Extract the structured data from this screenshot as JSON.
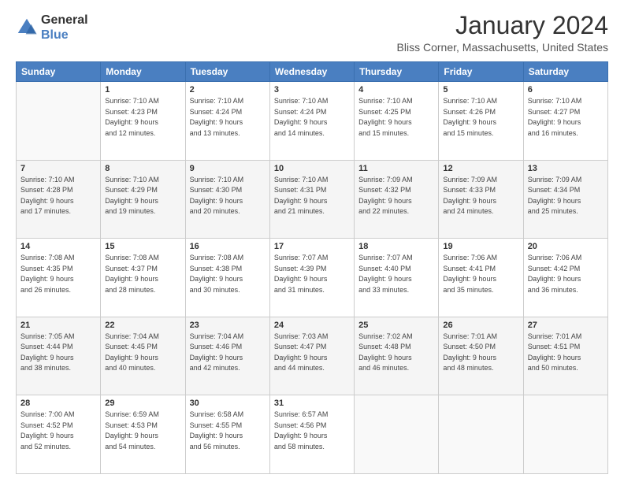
{
  "header": {
    "logo": {
      "line1": "General",
      "line2": "Blue"
    },
    "title": "January 2024",
    "subtitle": "Bliss Corner, Massachusetts, United States"
  },
  "calendar": {
    "days_of_week": [
      "Sunday",
      "Monday",
      "Tuesday",
      "Wednesday",
      "Thursday",
      "Friday",
      "Saturday"
    ],
    "weeks": [
      [
        {
          "day": "",
          "info": ""
        },
        {
          "day": "1",
          "info": "Sunrise: 7:10 AM\nSunset: 4:23 PM\nDaylight: 9 hours\nand 12 minutes."
        },
        {
          "day": "2",
          "info": "Sunrise: 7:10 AM\nSunset: 4:24 PM\nDaylight: 9 hours\nand 13 minutes."
        },
        {
          "day": "3",
          "info": "Sunrise: 7:10 AM\nSunset: 4:24 PM\nDaylight: 9 hours\nand 14 minutes."
        },
        {
          "day": "4",
          "info": "Sunrise: 7:10 AM\nSunset: 4:25 PM\nDaylight: 9 hours\nand 15 minutes."
        },
        {
          "day": "5",
          "info": "Sunrise: 7:10 AM\nSunset: 4:26 PM\nDaylight: 9 hours\nand 15 minutes."
        },
        {
          "day": "6",
          "info": "Sunrise: 7:10 AM\nSunset: 4:27 PM\nDaylight: 9 hours\nand 16 minutes."
        }
      ],
      [
        {
          "day": "7",
          "info": "Sunrise: 7:10 AM\nSunset: 4:28 PM\nDaylight: 9 hours\nand 17 minutes."
        },
        {
          "day": "8",
          "info": "Sunrise: 7:10 AM\nSunset: 4:29 PM\nDaylight: 9 hours\nand 19 minutes."
        },
        {
          "day": "9",
          "info": "Sunrise: 7:10 AM\nSunset: 4:30 PM\nDaylight: 9 hours\nand 20 minutes."
        },
        {
          "day": "10",
          "info": "Sunrise: 7:10 AM\nSunset: 4:31 PM\nDaylight: 9 hours\nand 21 minutes."
        },
        {
          "day": "11",
          "info": "Sunrise: 7:09 AM\nSunset: 4:32 PM\nDaylight: 9 hours\nand 22 minutes."
        },
        {
          "day": "12",
          "info": "Sunrise: 7:09 AM\nSunset: 4:33 PM\nDaylight: 9 hours\nand 24 minutes."
        },
        {
          "day": "13",
          "info": "Sunrise: 7:09 AM\nSunset: 4:34 PM\nDaylight: 9 hours\nand 25 minutes."
        }
      ],
      [
        {
          "day": "14",
          "info": "Sunrise: 7:08 AM\nSunset: 4:35 PM\nDaylight: 9 hours\nand 26 minutes."
        },
        {
          "day": "15",
          "info": "Sunrise: 7:08 AM\nSunset: 4:37 PM\nDaylight: 9 hours\nand 28 minutes."
        },
        {
          "day": "16",
          "info": "Sunrise: 7:08 AM\nSunset: 4:38 PM\nDaylight: 9 hours\nand 30 minutes."
        },
        {
          "day": "17",
          "info": "Sunrise: 7:07 AM\nSunset: 4:39 PM\nDaylight: 9 hours\nand 31 minutes."
        },
        {
          "day": "18",
          "info": "Sunrise: 7:07 AM\nSunset: 4:40 PM\nDaylight: 9 hours\nand 33 minutes."
        },
        {
          "day": "19",
          "info": "Sunrise: 7:06 AM\nSunset: 4:41 PM\nDaylight: 9 hours\nand 35 minutes."
        },
        {
          "day": "20",
          "info": "Sunrise: 7:06 AM\nSunset: 4:42 PM\nDaylight: 9 hours\nand 36 minutes."
        }
      ],
      [
        {
          "day": "21",
          "info": "Sunrise: 7:05 AM\nSunset: 4:44 PM\nDaylight: 9 hours\nand 38 minutes."
        },
        {
          "day": "22",
          "info": "Sunrise: 7:04 AM\nSunset: 4:45 PM\nDaylight: 9 hours\nand 40 minutes."
        },
        {
          "day": "23",
          "info": "Sunrise: 7:04 AM\nSunset: 4:46 PM\nDaylight: 9 hours\nand 42 minutes."
        },
        {
          "day": "24",
          "info": "Sunrise: 7:03 AM\nSunset: 4:47 PM\nDaylight: 9 hours\nand 44 minutes."
        },
        {
          "day": "25",
          "info": "Sunrise: 7:02 AM\nSunset: 4:48 PM\nDaylight: 9 hours\nand 46 minutes."
        },
        {
          "day": "26",
          "info": "Sunrise: 7:01 AM\nSunset: 4:50 PM\nDaylight: 9 hours\nand 48 minutes."
        },
        {
          "day": "27",
          "info": "Sunrise: 7:01 AM\nSunset: 4:51 PM\nDaylight: 9 hours\nand 50 minutes."
        }
      ],
      [
        {
          "day": "28",
          "info": "Sunrise: 7:00 AM\nSunset: 4:52 PM\nDaylight: 9 hours\nand 52 minutes."
        },
        {
          "day": "29",
          "info": "Sunrise: 6:59 AM\nSunset: 4:53 PM\nDaylight: 9 hours\nand 54 minutes."
        },
        {
          "day": "30",
          "info": "Sunrise: 6:58 AM\nSunset: 4:55 PM\nDaylight: 9 hours\nand 56 minutes."
        },
        {
          "day": "31",
          "info": "Sunrise: 6:57 AM\nSunset: 4:56 PM\nDaylight: 9 hours\nand 58 minutes."
        },
        {
          "day": "",
          "info": ""
        },
        {
          "day": "",
          "info": ""
        },
        {
          "day": "",
          "info": ""
        }
      ]
    ]
  },
  "colors": {
    "header_bg": "#4a7fc1",
    "header_text": "#ffffff",
    "border": "#cccccc",
    "alt_row": "#f5f5f5"
  }
}
